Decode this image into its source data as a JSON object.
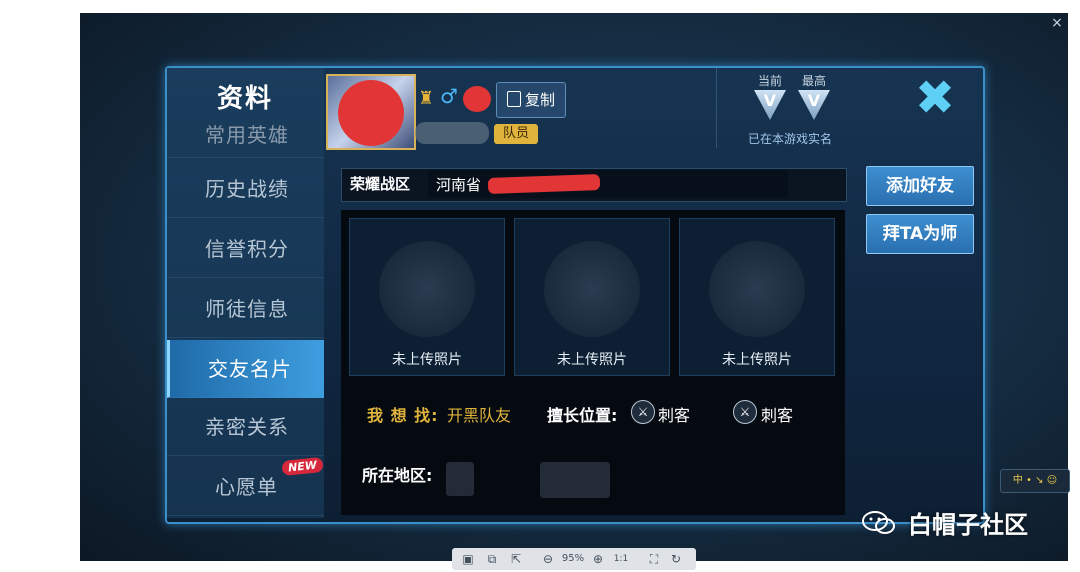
{
  "viewer": {
    "close_glyph": "×",
    "zoom": "95%",
    "toolbar_icons": [
      "save-icon",
      "share-icon",
      "export-icon",
      "zoom-out-icon",
      "zoom-in-icon",
      "actual-size-icon",
      "fit-icon",
      "rotate-icon"
    ]
  },
  "sidebar": {
    "title": "资料",
    "items": [
      {
        "label": "常用英雄",
        "active": false
      },
      {
        "label": "历史战绩",
        "active": false
      },
      {
        "label": "信誉积分",
        "active": false
      },
      {
        "label": "师徒信息",
        "active": false
      },
      {
        "label": "交友名片",
        "active": true
      },
      {
        "label": "亲密关系",
        "active": false
      },
      {
        "label": "心愿单",
        "active": false
      }
    ],
    "new_badge": "NEW"
  },
  "header": {
    "copy_label": "复制",
    "team_label": "队员",
    "gender_icon": "♂",
    "tier_current_label": "当前",
    "tier_max_label": "最高",
    "tier_current_glyph": "V",
    "tier_max_glyph": "V",
    "tier_note": "已在本游戏实名",
    "close_glyph": "✖"
  },
  "region": {
    "label": "荣耀战区",
    "value": "河南省"
  },
  "photos": [
    {
      "label": "未上传照片"
    },
    {
      "label": "未上传照片"
    },
    {
      "label": "未上传照片"
    }
  ],
  "seek": {
    "label": "我 想 找:",
    "value": "开黑队友"
  },
  "position": {
    "label": "擅长位置:",
    "roles": [
      "刺客",
      "刺客"
    ]
  },
  "location": {
    "label": "所在地区:"
  },
  "actions": {
    "add_friend": "添加好友",
    "apprentice": "拜TA为师"
  },
  "watermark": {
    "text": "白帽子社区",
    "icon": "wechat-icon"
  },
  "right_tools": {
    "glyphs": "中 • ↘ ☺"
  }
}
